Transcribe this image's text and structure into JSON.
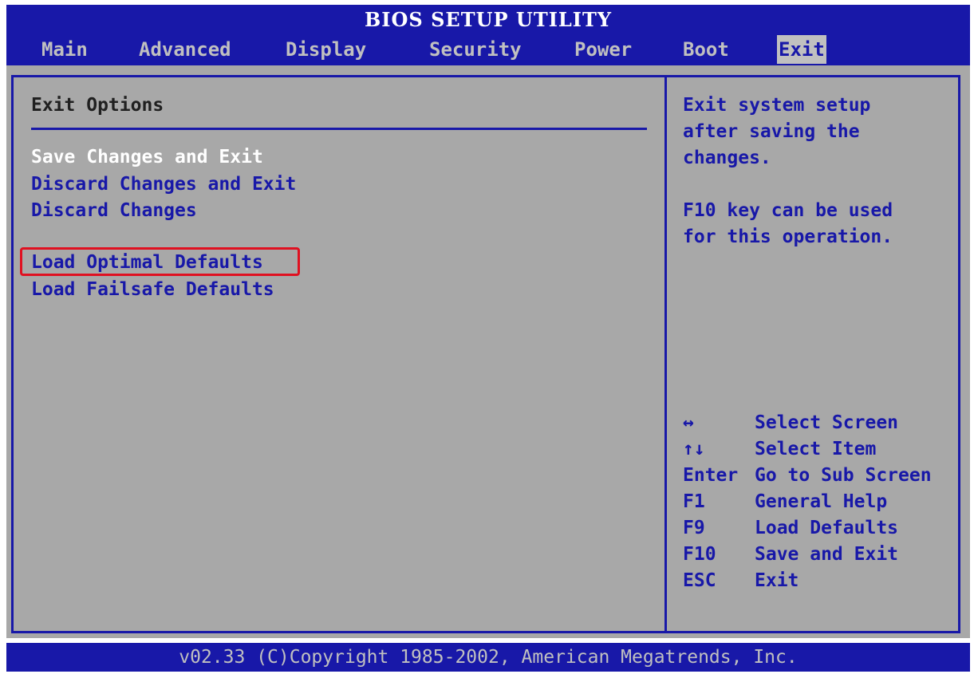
{
  "title": "BIOS SETUP UTILITY",
  "tabs": [
    {
      "label": "Main"
    },
    {
      "label": "Advanced"
    },
    {
      "label": "Display"
    },
    {
      "label": "Security"
    },
    {
      "label": "Power"
    },
    {
      "label": "Boot"
    },
    {
      "label": "Exit",
      "active": true
    }
  ],
  "left": {
    "section_title": "Exit Options",
    "options": [
      {
        "label": "Save Changes and Exit",
        "selected": true
      },
      {
        "label": "Discard Changes and Exit"
      },
      {
        "label": "Discard Changes"
      },
      {
        "label": "Load Optimal Defaults",
        "highlighted": true
      },
      {
        "label": "Load Failsafe Defaults"
      }
    ]
  },
  "help": {
    "lines": [
      "Exit system setup",
      "after saving the",
      "changes.",
      "F10 key can be used",
      "for this operation."
    ],
    "keys": [
      {
        "key": "↔",
        "action": "Select Screen"
      },
      {
        "key": "↑↓",
        "action": "Select Item"
      },
      {
        "key": "Enter",
        "action": "Go to Sub Screen"
      },
      {
        "key": "F1",
        "action": "General Help"
      },
      {
        "key": "F9",
        "action": "Load Defaults"
      },
      {
        "key": "F10",
        "action": "Save and Exit"
      },
      {
        "key": "ESC",
        "action": "Exit"
      }
    ]
  },
  "footer": "v02.33 (C)Copyright 1985-2002, American Megatrends, Inc.",
  "colors": {
    "bios_blue": "#1818a8",
    "panel_gray": "#a8a8a8",
    "selected_text": "#ffffff",
    "highlight_box": "#e01020"
  }
}
